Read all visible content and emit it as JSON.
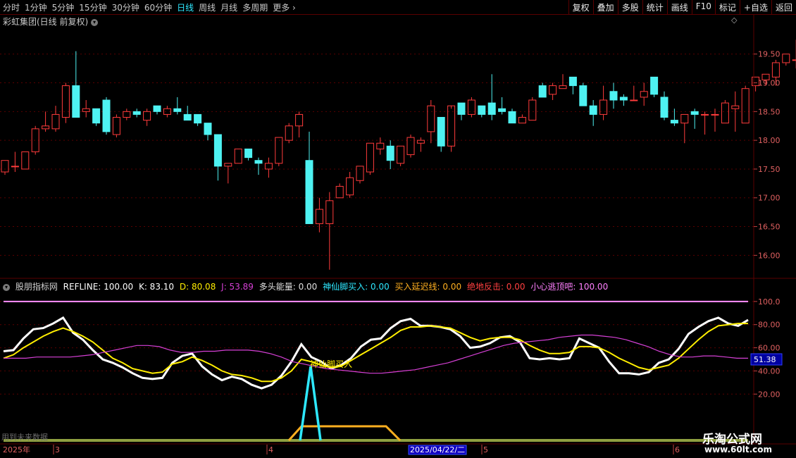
{
  "toolbar": {
    "periods": [
      "分时",
      "1分钟",
      "5分钟",
      "15分钟",
      "30分钟",
      "60分钟",
      "日线",
      "周线",
      "月线",
      "多周期",
      "更多"
    ],
    "active_period": "日线",
    "right_buttons": [
      "复权",
      "叠加",
      "多股",
      "统计",
      "画线",
      "F10",
      "标记",
      "+自选",
      "返回"
    ]
  },
  "stock": {
    "title": "彩虹集团(日线 前复权)"
  },
  "colors": {
    "up": "#ff3b3b",
    "down": "#4ef2f2",
    "grid": "#5a0000",
    "bg": "#000000"
  },
  "indicator": {
    "name": "股朋指标网",
    "refline": "REFLINE: 100.00",
    "k": "K: 83.10",
    "d": "D: 80.08",
    "j": "J: 53.89",
    "multi_energy": "多头能量: 0.00",
    "immortal_buy": "神仙脚买入: 0.00",
    "delayed_buy": "买入延迟线: 0.00",
    "rebound": "绝地反击: 0.00",
    "top_warn": "小心逃顶吧: 100.00",
    "signal_label": "神仙脚买入",
    "value_badge": "51.38",
    "future_note": "用到未来数据"
  },
  "watermark": {
    "line1": "乐淘公式网",
    "line2": "www.60lt.com"
  },
  "x_axis": {
    "year_label": "2025年",
    "month_labels": [
      "3",
      "4",
      "5",
      "6"
    ],
    "cursor_date": "2025/04/22/二"
  },
  "chart_data": [
    {
      "type": "candlestick",
      "title": "彩虹集团(日线 前复权)",
      "ylim": [
        15.6,
        19.95
      ],
      "y_ticks": [
        "19.50",
        "19.00",
        "18.50",
        "18.00",
        "17.50",
        "17.00",
        "16.50",
        "16.00"
      ],
      "candles": [
        {
          "o": 17.45,
          "h": 17.65,
          "l": 17.4,
          "c": 17.65
        },
        {
          "o": 17.55,
          "h": 17.8,
          "l": 17.45,
          "c": 17.55
        },
        {
          "o": 17.5,
          "h": 17.8,
          "l": 17.5,
          "c": 17.8
        },
        {
          "o": 17.8,
          "h": 18.25,
          "l": 17.75,
          "c": 18.2
        },
        {
          "o": 18.2,
          "h": 18.5,
          "l": 18.15,
          "c": 18.25
        },
        {
          "o": 18.2,
          "h": 18.6,
          "l": 18.15,
          "c": 18.45
        },
        {
          "o": 18.4,
          "h": 19.0,
          "l": 18.3,
          "c": 18.95
        },
        {
          "o": 18.95,
          "h": 19.55,
          "l": 18.4,
          "c": 18.4
        },
        {
          "o": 18.5,
          "h": 18.7,
          "l": 18.4,
          "c": 18.55
        },
        {
          "o": 18.55,
          "h": 18.55,
          "l": 18.25,
          "c": 18.3
        },
        {
          "o": 18.7,
          "h": 18.75,
          "l": 18.1,
          "c": 18.15
        },
        {
          "o": 18.1,
          "h": 18.45,
          "l": 18.05,
          "c": 18.4
        },
        {
          "o": 18.4,
          "h": 18.55,
          "l": 18.35,
          "c": 18.5
        },
        {
          "o": 18.5,
          "h": 18.55,
          "l": 18.4,
          "c": 18.45
        },
        {
          "o": 18.35,
          "h": 18.55,
          "l": 18.25,
          "c": 18.5
        },
        {
          "o": 18.6,
          "h": 18.6,
          "l": 18.45,
          "c": 18.5
        },
        {
          "o": 18.45,
          "h": 18.6,
          "l": 18.4,
          "c": 18.55
        },
        {
          "o": 18.55,
          "h": 18.75,
          "l": 18.45,
          "c": 18.5
        },
        {
          "o": 18.45,
          "h": 18.6,
          "l": 18.4,
          "c": 18.35
        },
        {
          "o": 18.45,
          "h": 18.45,
          "l": 18.25,
          "c": 18.3
        },
        {
          "o": 18.3,
          "h": 18.3,
          "l": 18.0,
          "c": 18.1
        },
        {
          "o": 18.1,
          "h": 18.1,
          "l": 17.3,
          "c": 17.55
        },
        {
          "o": 17.55,
          "h": 17.6,
          "l": 17.25,
          "c": 17.6
        },
        {
          "o": 17.6,
          "h": 17.85,
          "l": 17.6,
          "c": 17.85
        },
        {
          "o": 17.85,
          "h": 17.85,
          "l": 17.65,
          "c": 17.7
        },
        {
          "o": 17.65,
          "h": 17.7,
          "l": 17.4,
          "c": 17.6
        },
        {
          "o": 17.5,
          "h": 17.7,
          "l": 17.35,
          "c": 17.6
        },
        {
          "o": 17.6,
          "h": 18.05,
          "l": 17.55,
          "c": 18.05
        },
        {
          "o": 18.0,
          "h": 18.3,
          "l": 17.95,
          "c": 18.25
        },
        {
          "o": 18.25,
          "h": 18.5,
          "l": 18.05,
          "c": 18.45
        },
        {
          "o": 17.65,
          "h": 18.15,
          "l": 16.55,
          "c": 16.55
        },
        {
          "o": 16.55,
          "h": 17.0,
          "l": 16.4,
          "c": 16.8
        },
        {
          "o": 16.55,
          "h": 17.1,
          "l": 15.75,
          "c": 16.95
        },
        {
          "o": 17.0,
          "h": 17.25,
          "l": 17.0,
          "c": 17.2
        },
        {
          "o": 17.05,
          "h": 17.45,
          "l": 17.0,
          "c": 17.35
        },
        {
          "o": 17.3,
          "h": 17.55,
          "l": 17.25,
          "c": 17.55
        },
        {
          "o": 17.45,
          "h": 17.95,
          "l": 17.4,
          "c": 17.95
        },
        {
          "o": 17.85,
          "h": 18.05,
          "l": 17.75,
          "c": 17.95
        },
        {
          "o": 17.9,
          "h": 18.0,
          "l": 17.5,
          "c": 17.65
        },
        {
          "o": 17.6,
          "h": 17.9,
          "l": 17.55,
          "c": 17.9
        },
        {
          "o": 17.75,
          "h": 18.1,
          "l": 17.7,
          "c": 18.05
        },
        {
          "o": 17.95,
          "h": 18.05,
          "l": 17.8,
          "c": 18.0
        },
        {
          "o": 18.15,
          "h": 18.7,
          "l": 17.95,
          "c": 18.6
        },
        {
          "o": 18.4,
          "h": 18.4,
          "l": 17.8,
          "c": 17.9
        },
        {
          "o": 17.9,
          "h": 18.55,
          "l": 17.8,
          "c": 18.6
        },
        {
          "o": 18.65,
          "h": 18.6,
          "l": 18.35,
          "c": 18.45
        },
        {
          "o": 18.45,
          "h": 18.75,
          "l": 18.4,
          "c": 18.7
        },
        {
          "o": 18.6,
          "h": 18.55,
          "l": 18.4,
          "c": 18.45
        },
        {
          "o": 18.65,
          "h": 19.15,
          "l": 18.35,
          "c": 18.45
        },
        {
          "o": 18.55,
          "h": 18.75,
          "l": 18.45,
          "c": 18.5
        },
        {
          "o": 18.5,
          "h": 18.55,
          "l": 18.3,
          "c": 18.3
        },
        {
          "o": 18.3,
          "h": 18.45,
          "l": 18.3,
          "c": 18.4
        },
        {
          "o": 18.35,
          "h": 18.75,
          "l": 18.35,
          "c": 18.7
        },
        {
          "o": 18.95,
          "h": 19.0,
          "l": 18.75,
          "c": 18.75
        },
        {
          "o": 18.8,
          "h": 19.0,
          "l": 18.7,
          "c": 18.95
        },
        {
          "o": 18.9,
          "h": 19.15,
          "l": 18.9,
          "c": 18.95
        },
        {
          "o": 19.1,
          "h": 19.1,
          "l": 18.8,
          "c": 18.95
        },
        {
          "o": 18.95,
          "h": 19.0,
          "l": 18.6,
          "c": 18.6
        },
        {
          "o": 18.6,
          "h": 18.7,
          "l": 18.25,
          "c": 18.45
        },
        {
          "o": 18.45,
          "h": 18.95,
          "l": 18.35,
          "c": 18.7
        },
        {
          "o": 18.85,
          "h": 19.0,
          "l": 18.55,
          "c": 18.7
        },
        {
          "o": 18.75,
          "h": 18.8,
          "l": 18.6,
          "c": 18.7
        },
        {
          "o": 18.7,
          "h": 18.95,
          "l": 18.7,
          "c": 18.7
        },
        {
          "o": 18.75,
          "h": 19.0,
          "l": 18.6,
          "c": 18.85
        },
        {
          "o": 19.1,
          "h": 19.1,
          "l": 18.75,
          "c": 18.8
        },
        {
          "o": 18.75,
          "h": 18.85,
          "l": 18.35,
          "c": 18.4
        },
        {
          "o": 18.35,
          "h": 18.55,
          "l": 18.25,
          "c": 18.3
        },
        {
          "o": 18.3,
          "h": 18.45,
          "l": 17.95,
          "c": 18.45
        },
        {
          "o": 18.5,
          "h": 18.55,
          "l": 18.2,
          "c": 18.45
        },
        {
          "o": 18.45,
          "h": 18.5,
          "l": 18.1,
          "c": 18.45
        },
        {
          "o": 18.45,
          "h": 18.55,
          "l": 18.15,
          "c": 18.45
        },
        {
          "o": 18.3,
          "h": 18.7,
          "l": 18.3,
          "c": 18.65
        },
        {
          "o": 18.55,
          "h": 18.85,
          "l": 18.15,
          "c": 18.6
        },
        {
          "o": 18.3,
          "h": 18.95,
          "l": 18.3,
          "c": 18.9
        },
        {
          "o": 18.95,
          "h": 19.1,
          "l": 18.85,
          "c": 19.1
        },
        {
          "o": 19.05,
          "h": 19.15,
          "l": 18.95,
          "c": 19.15
        },
        {
          "o": 19.1,
          "h": 19.4,
          "l": 18.95,
          "c": 19.35
        },
        {
          "o": 19.35,
          "h": 19.5,
          "l": 19.3,
          "c": 19.5
        },
        {
          "o": 19.4,
          "h": 19.75,
          "l": 19.25,
          "c": 19.4
        },
        {
          "o": 19.4,
          "h": 19.55,
          "l": 19.3,
          "c": 19.4
        },
        {
          "o": 19.35,
          "h": 19.8,
          "l": 19.15,
          "c": 19.75
        }
      ]
    },
    {
      "type": "line",
      "ylim": [
        10,
        100
      ],
      "y_ticks": [
        "100.0",
        "80.00",
        "60.00",
        "40.00",
        "20.00"
      ],
      "series": [
        {
          "name": "K",
          "color": "#ffffff",
          "values": [
            57,
            58,
            68,
            76,
            77,
            81,
            86,
            73,
            67,
            58,
            50,
            47,
            43,
            38,
            34,
            33,
            34,
            47,
            53,
            55,
            44,
            37,
            32,
            35,
            33,
            28,
            25,
            28,
            36,
            48,
            63,
            52,
            48,
            42,
            45,
            51,
            61,
            67,
            68,
            77,
            83,
            85,
            79,
            79,
            78,
            76,
            70,
            60,
            61,
            64,
            69,
            70,
            65,
            51,
            50,
            51,
            50,
            51,
            68,
            64,
            60,
            48,
            38,
            38,
            37,
            39,
            47,
            50,
            59,
            72,
            78,
            83,
            86,
            81,
            79,
            84
          ]
        },
        {
          "name": "D",
          "color": "#ffee00",
          "values": [
            51,
            54,
            60,
            65,
            70,
            74,
            77,
            74,
            70,
            65,
            58,
            51,
            47,
            42,
            40,
            38,
            39,
            46,
            48,
            52,
            49,
            45,
            40,
            37,
            36,
            34,
            31,
            31,
            34,
            40,
            50,
            48,
            45,
            43,
            44,
            49,
            54,
            59,
            64,
            69,
            75,
            78,
            78,
            79,
            78,
            77,
            73,
            69,
            66,
            68,
            69,
            69,
            67,
            62,
            58,
            55,
            55,
            56,
            61,
            61,
            60,
            56,
            51,
            47,
            43,
            41,
            43,
            45,
            51,
            59,
            67,
            74,
            79,
            80,
            81,
            81
          ]
        },
        {
          "name": "J",
          "color": "#d640d6",
          "values": [
            51,
            51,
            51,
            52,
            52,
            52,
            52,
            53,
            54,
            56,
            58,
            60,
            62,
            62,
            61,
            58,
            56,
            56,
            57,
            57,
            58,
            58,
            58,
            57,
            55,
            52,
            48,
            46,
            44,
            42,
            41,
            40,
            39,
            38,
            38,
            39,
            40,
            41,
            43,
            45,
            47,
            50,
            53,
            56,
            59,
            62,
            64,
            65,
            66,
            67,
            69,
            70,
            71,
            71,
            70,
            69,
            67,
            64,
            61,
            57,
            54,
            52,
            52,
            53,
            53,
            52,
            51,
            51
          ]
        },
        {
          "name": "REFLINE",
          "color": "#ff90ff",
          "values": [
            100
          ]
        }
      ]
    }
  ]
}
